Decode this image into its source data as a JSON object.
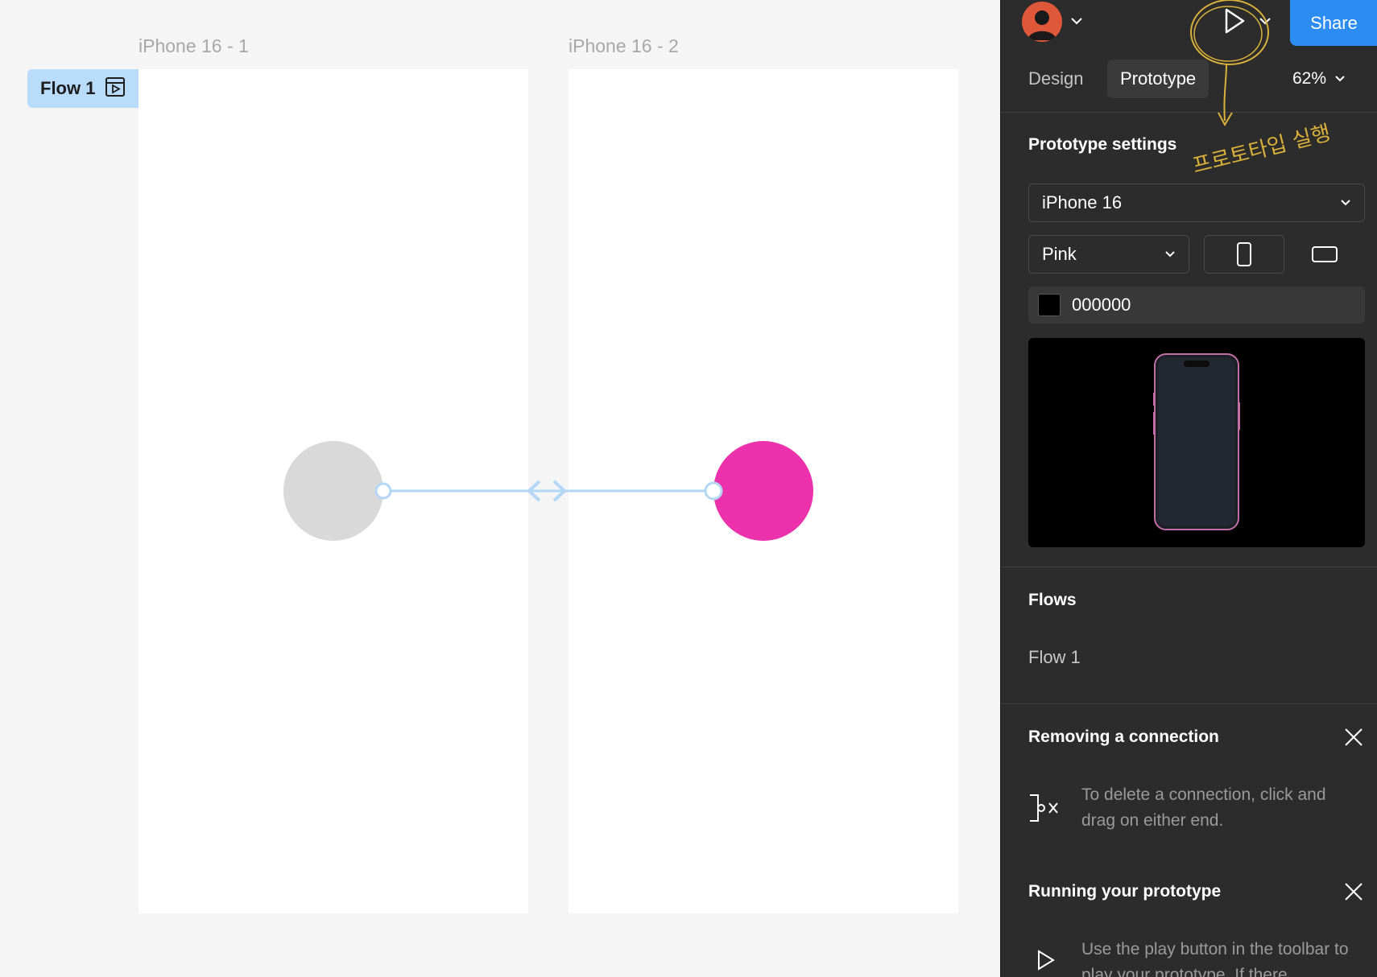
{
  "canvas": {
    "frames": [
      {
        "label": "iPhone 16 - 1"
      },
      {
        "label": "iPhone 16 - 2"
      }
    ],
    "flow_badge": {
      "label": "Flow 1",
      "icon": "flow-play-icon"
    },
    "shapes": {
      "left_circle_color": "#d9d9d9",
      "right_circle_color": "#eb31ab",
      "connection_color": "#b4d7f5"
    }
  },
  "panel": {
    "toolbar": {
      "avatar_icon": "user-avatar-icon",
      "play_icon": "play-icon",
      "share_label": "Share",
      "accent": "#2b8df2"
    },
    "tabs": [
      {
        "label": "Design",
        "active": false
      },
      {
        "label": "Prototype",
        "active": true
      }
    ],
    "zoom": "62%",
    "prototype_settings": {
      "title": "Prototype settings",
      "device": "iPhone 16",
      "color_model": "Pink",
      "orientation_portrait_icon": "portrait-icon",
      "orientation_landscape_icon": "landscape-icon",
      "background_hex": "000000",
      "background_color": "#000000"
    },
    "flows": {
      "title": "Flows",
      "items": [
        "Flow 1"
      ]
    },
    "tips": [
      {
        "title": "Removing a connection",
        "text": "To delete a connection, click and drag on either end.",
        "icon": "disconnect-icon"
      },
      {
        "title": "Running your prototype",
        "text": "Use the play button in the toolbar to play your prototype. If there",
        "icon": "play-outline-icon"
      }
    ],
    "annotation": {
      "text": "프로토타입 실행",
      "color": "#d9b13b"
    }
  }
}
